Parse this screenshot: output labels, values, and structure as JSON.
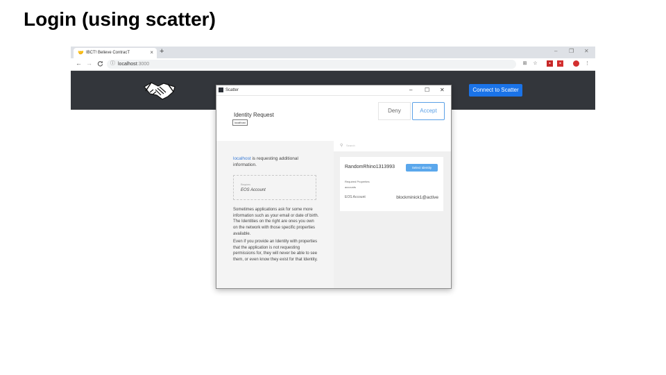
{
  "slide": {
    "title": "Login (using scatter)"
  },
  "browser": {
    "tab_title": "IBCT! Believe ContracT",
    "tab_close": "×",
    "new_tab": "+",
    "window_controls": [
      "–",
      "❐",
      "✕"
    ],
    "nav": [
      "←",
      "→",
      "C"
    ],
    "url_host": "localhost",
    "url_port": ":3000"
  },
  "app": {
    "connect_button": "Connect to Scatter"
  },
  "scatter": {
    "window_title": "Scatter",
    "window_controls": [
      "–",
      "☐",
      "✕"
    ],
    "heading": "Identity Request",
    "host_tag": "localhost",
    "deny": "Deny",
    "accept": "Accept",
    "search_placeholder": "Search",
    "request_host": "localhost",
    "request_suffix": " is requesting additional information.",
    "required_label": "Requires",
    "required_value": "EOS Account",
    "paragraph1": "Sometimes applications ask for some more information such as your email or date of birth. The Identities on the right are ones you own on the network with those specific properties available.",
    "paragraph2": "Even if you provide an Identity with properties that the application is not requesting permissions for, they will never be able to see them, or even know they exist for that Identity.",
    "identity": {
      "name": "RandomRhino1313993",
      "select_button": "Select Identity",
      "required_properties_label": "Required Properties",
      "required_properties_value": "accounts",
      "eos_label": "EOS Account",
      "eos_value": "blockminick1@active"
    }
  },
  "colors": {
    "app_header": "#33363b",
    "primary_blue": "#1a73e8",
    "scatter_accent": "#5aa7ec"
  }
}
